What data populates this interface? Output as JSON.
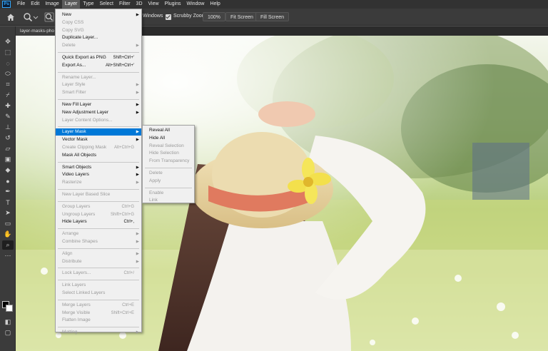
{
  "app": {
    "logo": "Ps"
  },
  "menubar": [
    "File",
    "Edit",
    "Image",
    "Layer",
    "Type",
    "Select",
    "Filter",
    "3D",
    "View",
    "Plugins",
    "Window",
    "Help"
  ],
  "options": {
    "windows_label": "Windows",
    "scrubby_zoom_label": "Scrubby Zoom",
    "zoom_value": "100%",
    "fit_screen_label": "Fit Screen",
    "fill_screen_label": "Fill Screen"
  },
  "document": {
    "tab_title": "layer-masks-pho"
  },
  "layer_menu": [
    {
      "label": "New",
      "arrow": true
    },
    {
      "label": "Copy CSS",
      "disabled": true
    },
    {
      "label": "Copy SVG",
      "disabled": true
    },
    {
      "label": "Duplicate Layer..."
    },
    {
      "label": "Delete",
      "arrow": true,
      "disabled": true
    },
    {
      "sep": true
    },
    {
      "label": "Quick Export as PNG",
      "shortcut": "Shift+Ctrl+'"
    },
    {
      "label": "Export As...",
      "shortcut": "Alt+Shift+Ctrl+'"
    },
    {
      "sep": true
    },
    {
      "label": "Rename Layer...",
      "disabled": true
    },
    {
      "label": "Layer Style",
      "arrow": true,
      "disabled": true
    },
    {
      "label": "Smart Filter",
      "arrow": true,
      "disabled": true
    },
    {
      "sep": true
    },
    {
      "label": "New Fill Layer",
      "arrow": true
    },
    {
      "label": "New Adjustment Layer",
      "arrow": true
    },
    {
      "label": "Layer Content Options...",
      "disabled": true
    },
    {
      "sep": true
    },
    {
      "label": "Layer Mask",
      "arrow": true,
      "highlighted": true
    },
    {
      "label": "Vector Mask",
      "arrow": true
    },
    {
      "label": "Create Clipping Mask",
      "shortcut": "Alt+Ctrl+G",
      "disabled": true
    },
    {
      "label": "Mask All Objects"
    },
    {
      "sep": true
    },
    {
      "label": "Smart Objects",
      "arrow": true
    },
    {
      "label": "Video Layers",
      "arrow": true
    },
    {
      "label": "Rasterize",
      "arrow": true,
      "disabled": true
    },
    {
      "sep": true
    },
    {
      "label": "New Layer Based Slice",
      "disabled": true
    },
    {
      "sep": true
    },
    {
      "label": "Group Layers",
      "shortcut": "Ctrl+G",
      "disabled": true
    },
    {
      "label": "Ungroup Layers",
      "shortcut": "Shift+Ctrl+G",
      "disabled": true
    },
    {
      "label": "Hide Layers",
      "shortcut": "Ctrl+,"
    },
    {
      "sep": true
    },
    {
      "label": "Arrange",
      "arrow": true,
      "disabled": true
    },
    {
      "label": "Combine Shapes",
      "arrow": true,
      "disabled": true
    },
    {
      "sep": true
    },
    {
      "label": "Align",
      "arrow": true,
      "disabled": true
    },
    {
      "label": "Distribute",
      "arrow": true,
      "disabled": true
    },
    {
      "sep": true
    },
    {
      "label": "Lock Layers...",
      "shortcut": "Ctrl+/",
      "disabled": true
    },
    {
      "sep": true
    },
    {
      "label": "Link Layers",
      "disabled": true
    },
    {
      "label": "Select Linked Layers",
      "disabled": true
    },
    {
      "sep": true
    },
    {
      "label": "Merge Layers",
      "shortcut": "Ctrl+E",
      "disabled": true
    },
    {
      "label": "Merge Visible",
      "shortcut": "Shift+Ctrl+E",
      "disabled": true
    },
    {
      "label": "Flatten Image",
      "disabled": true
    },
    {
      "sep": true
    },
    {
      "label": "Matting",
      "arrow": true,
      "disabled": true
    }
  ],
  "layer_mask_submenu": [
    {
      "label": "Reveal All"
    },
    {
      "label": "Hide All"
    },
    {
      "label": "Reveal Selection",
      "disabled": true
    },
    {
      "label": "Hide Selection",
      "disabled": true
    },
    {
      "label": "From Transparency",
      "disabled": true
    },
    {
      "sep": true
    },
    {
      "label": "Delete",
      "disabled": true
    },
    {
      "label": "Apply",
      "disabled": true
    },
    {
      "sep": true
    },
    {
      "label": "Enable",
      "disabled": true
    },
    {
      "label": "Link",
      "disabled": true
    }
  ],
  "tools": [
    "move",
    "marquee",
    "lasso",
    "quick-select",
    "crop",
    "eyedropper",
    "healing-brush",
    "brush",
    "clone-stamp",
    "history-brush",
    "eraser",
    "gradient",
    "blur",
    "dodge",
    "pen",
    "type",
    "path-select",
    "rectangle",
    "hand",
    "zoom",
    "more"
  ],
  "colors": {
    "accent": "#0078d7",
    "foreground": "#000000",
    "background": "#ffffff"
  }
}
